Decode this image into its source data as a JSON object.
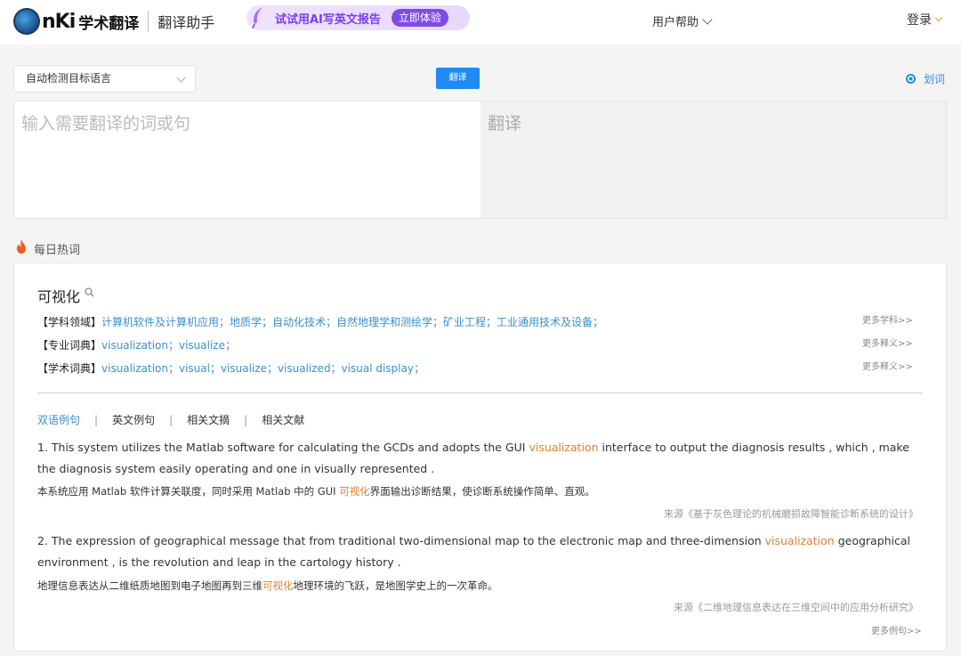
{
  "header": {
    "logo_text": "nKi",
    "logo_title": "学术翻译",
    "logo_sub": "翻译助手",
    "promo_text": "试试用AI写英文报告",
    "promo_button": "立即体验",
    "help": "用户帮助",
    "login": "登录"
  },
  "toolbar": {
    "lang_select": "自动检测目标语言",
    "translate_button": "翻译",
    "select_word": "划词"
  },
  "panel": {
    "input_placeholder": "输入需要翻译的词或句",
    "output_placeholder": "翻译"
  },
  "hot": {
    "title": "每日热词",
    "word": "可视化",
    "rows": [
      {
        "label": "【学科领域】",
        "value": "计算机软件及计算机应用；地质学；自动化技术；自然地理学和测绘学；矿业工程；工业通用技术及设备；",
        "more": "更多学科>>"
      },
      {
        "label": "【专业词典】",
        "value": "visualization；visualize；",
        "more": "更多释义>>"
      },
      {
        "label": "【学术词典】",
        "value": "visualization；visual；visualize；visualized；visual display；",
        "more": "更多释义>>"
      }
    ],
    "tabs": [
      "双语例句",
      "英文例句",
      "相关文摘",
      "相关文献"
    ],
    "examples": [
      {
        "en_before": "1. This system utilizes the Matlab software for calculating the GCDs and adopts the GUI ",
        "en_hl": "visualization",
        "en_after": " interface to output the diagnosis results , which , make the diagnosis system easily operating and one in visually represented .",
        "zh_before": "本系统应用 Matlab 软件计算关联度，同时采用 Matlab 中的 GUI ",
        "zh_hl": "可视化",
        "zh_after": "界面输出诊断结果，使诊断系统操作简单、直观。",
        "source": "来源《基于灰色理论的机械磨损故障智能诊断系统的设计》"
      },
      {
        "en_before": "2. The expression of geographical message that from traditional two-dimensional map to the electronic map and three-dimension ",
        "en_hl": "visualization",
        "en_after": " geographical environment , is the revolution and leap in the cartology history .",
        "zh_before": "地理信息表达从二维纸质地图到电子地图再到三维",
        "zh_hl": "可视化",
        "zh_after": "地理环境的飞跃，是地图学史上的一次革命。",
        "source": "来源《二维地理信息表达在三维空间中的应用分析研究》"
      }
    ],
    "more_examples": "更多例句>>"
  },
  "colors": {
    "accent_blue": "#1e8cf2",
    "link_blue": "#3b8fd0",
    "highlight_orange": "#e08030",
    "promo_purple": "#7f4be8"
  }
}
